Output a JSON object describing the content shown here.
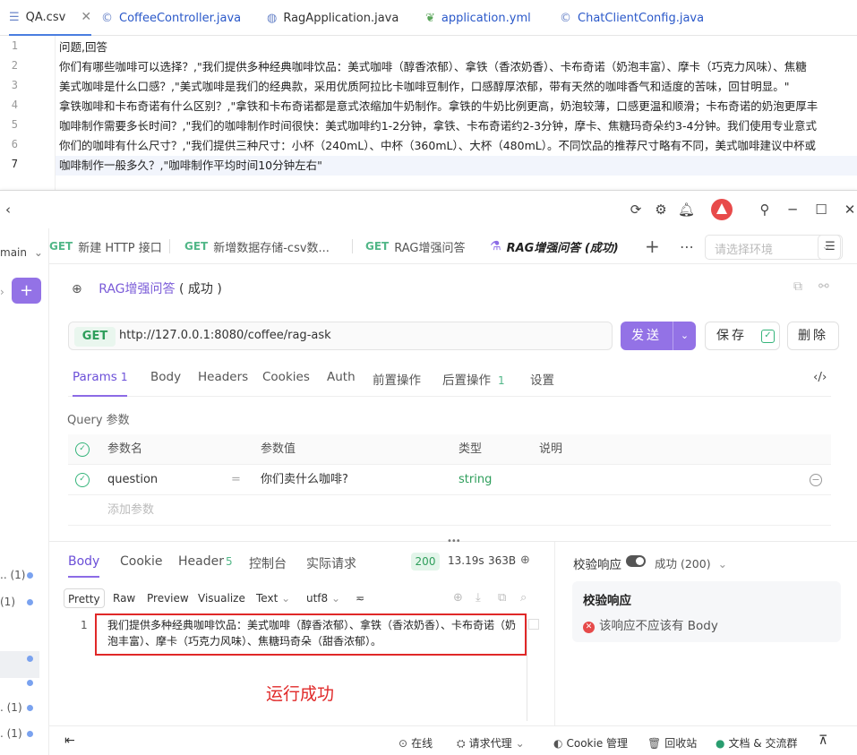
{
  "editor": {
    "tabs": [
      {
        "label": "QA.csv",
        "icon": "csv-file-icon",
        "active": true
      },
      {
        "label": "CoffeeController.java",
        "icon": "java-class-icon"
      },
      {
        "label": "RagApplication.java",
        "icon": "java-app-icon"
      },
      {
        "label": "application.yml",
        "icon": "yaml-icon"
      },
      {
        "label": "ChatClientConfig.java",
        "icon": "java-class-icon"
      }
    ],
    "line_numbers": [
      "1",
      "2",
      "3",
      "4",
      "5",
      "6",
      "7"
    ],
    "lines": [
      "问题,回答",
      "你们有哪些咖啡可以选择？,\"我们提供多种经典咖啡饮品：美式咖啡（醇香浓郁）、拿铁（香浓奶香）、卡布奇诺（奶泡丰富）、摩卡（巧克力风味）、焦糖",
      "美式咖啡是什么口感？,\"美式咖啡是我们的经典款，采用优质阿拉比卡咖啡豆制作，口感醇厚浓郁，带有天然的咖啡香气和适度的苦味，回甘明显。\"",
      "拿铁咖啡和卡布奇诺有什么区别？,\"拿铁和卡布奇诺都是意式浓缩加牛奶制作。拿铁的牛奶比例更高，奶泡较薄，口感更温和顺滑；卡布奇诺的奶泡更厚丰",
      "咖啡制作需要多长时间？,\"我们的咖啡制作时间很快：美式咖啡约1-2分钟，拿铁、卡布奇诺约2-3分钟，摩卡、焦糖玛奇朵约3-4分钟。我们使用专业意式",
      "你们的咖啡有什么尺寸？,\"我们提供三种尺寸：小杯（240mL）、中杯（360mL）、大杯（480mL）。不同饮品的推荐尺寸略有不同，美式咖啡建议中杯或",
      "咖啡制作一般多久？,\"咖啡制作平均时间10分钟左右\""
    ]
  },
  "sidebar": {
    "branch": "main",
    "counts": [
      ".. (1)",
      "(1)",
      ". (1)",
      ". (1)"
    ]
  },
  "request_tabs": [
    {
      "method": "GET",
      "label": "新建 HTTP 接口"
    },
    {
      "method": "GET",
      "label": "新增数据存储-csv数..."
    },
    {
      "method": "GET",
      "label": "RAG增强问答"
    },
    {
      "method": "",
      "label": "RAG增强问答 (成功)",
      "active": true
    }
  ],
  "env_select": {
    "placeholder": "请选择环境"
  },
  "request": {
    "name": "RAG增强问答",
    "status_suffix": "( 成功 )",
    "method": "GET",
    "url": "http://127.0.0.1:8080/coffee/rag-ask",
    "send_label": "发送",
    "save_label": "保存",
    "delete_label": "删除"
  },
  "param_tabs": [
    {
      "label": "Params",
      "count": "1",
      "active": true
    },
    {
      "label": "Body"
    },
    {
      "label": "Headers"
    },
    {
      "label": "Cookies"
    },
    {
      "label": "Auth"
    },
    {
      "label": "前置操作"
    },
    {
      "label": "后置操作",
      "count": "1"
    },
    {
      "label": "设置"
    }
  ],
  "query": {
    "title": "Query 参数",
    "headers": [
      "参数名",
      "参数值",
      "类型",
      "说明"
    ],
    "rows": [
      {
        "name": "question",
        "value": "你们卖什么咖啡?",
        "type": "string",
        "desc": ""
      }
    ],
    "add_placeholder": "添加参数"
  },
  "response": {
    "tabs": [
      {
        "label": "Body",
        "active": true
      },
      {
        "label": "Cookie"
      },
      {
        "label": "Header",
        "count": "5"
      },
      {
        "label": "控制台"
      },
      {
        "label": "实际请求"
      }
    ],
    "status": "200",
    "time": "13.19s",
    "size": "363B",
    "format_buttons": [
      "Pretty",
      "Raw",
      "Preview",
      "Visualize"
    ],
    "text_type": "Text",
    "encoding": "utf8",
    "line_no": "1",
    "body": "我们提供多种经典咖啡饮品：美式咖啡（醇香浓郁）、拿铁（香浓奶香）、卡布奇诺（奶泡丰富）、摩卡（巧克力风味）、焦糖玛奇朵（甜香浓郁）。",
    "annotation": "运行成功"
  },
  "verify": {
    "label": "校验响应",
    "status": "成功 (200)",
    "box_title": "校验响应",
    "error": "该响应不应该有 Body"
  },
  "footer": {
    "online": "在线",
    "proxy": "请求代理",
    "cookie": "Cookie 管理",
    "trash": "回收站",
    "docs": "文档 & 交流群"
  },
  "colors": {
    "accent": "#9372e6",
    "success": "#2e9e5b",
    "annotation": "#e02828"
  }
}
